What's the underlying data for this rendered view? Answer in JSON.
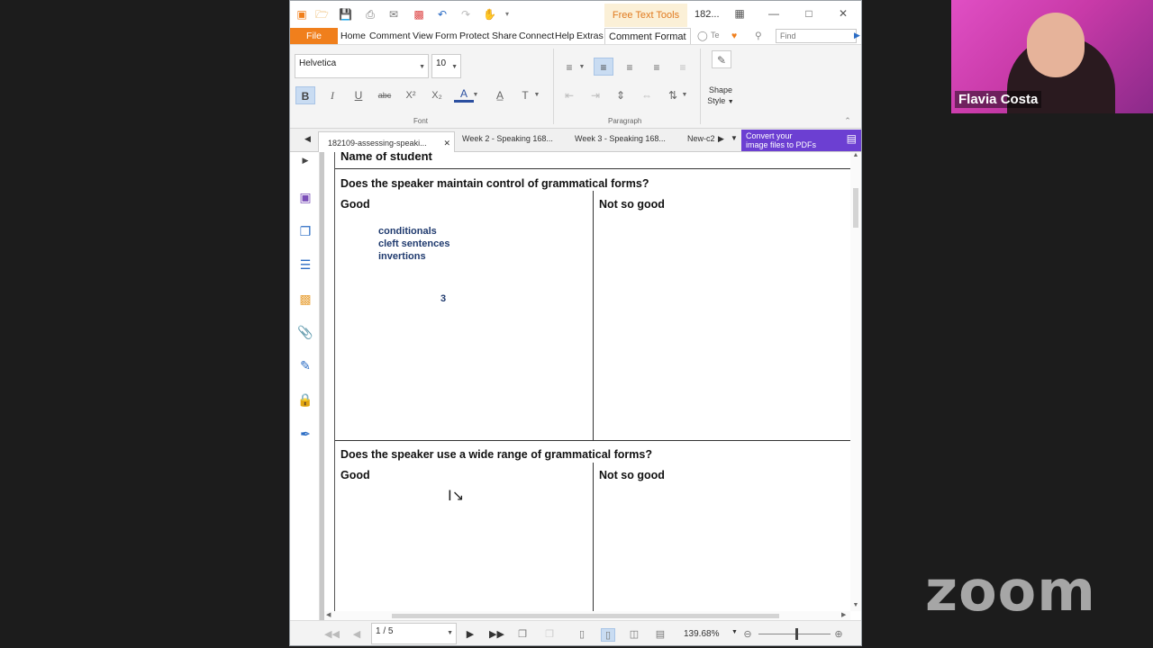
{
  "titlebar": {
    "active_tool_tab": "Free Text Tools",
    "doc_title": "182...",
    "colors": {
      "file_tab": "#f07f1c",
      "tool_tab_bg": "#fbf0d7",
      "tool_tab_text": "#e07a1f"
    }
  },
  "menu": {
    "file": "File",
    "items": [
      "Home",
      "Comment",
      "View",
      "Form",
      "Protect",
      "Share",
      "Connect",
      "Help",
      "Extras"
    ],
    "active": "Comment Format",
    "tell_me": "Te",
    "find_placeholder": "Find"
  },
  "ribbon": {
    "font_name": "Helvetica",
    "font_size": "10",
    "group_font": "Font",
    "group_paragraph": "Paragraph",
    "shape_style_1": "Shape",
    "shape_style_2": "Style"
  },
  "tabs": {
    "items": [
      "182109-assessing-speaki...",
      "Week 2 - Speaking 168...",
      "Week 3 - Speaking 168...",
      "New-c2"
    ],
    "banner_line1": "Convert your",
    "banner_line2": "image files to PDFs"
  },
  "document": {
    "name_of_student": "Name of student",
    "q1": "Does the speaker maintain control of grammatical forms?",
    "q1_good": "Good",
    "q1_not_good": "Not so good",
    "notes": [
      "conditionals",
      "cleft sentences",
      "invertions"
    ],
    "score": "3",
    "q2": "Does the speaker use a wide range of grammatical forms?",
    "q2_good": "Good",
    "q2_not_good": "Not so good"
  },
  "statusbar": {
    "page": "1 / 5",
    "zoom": "139.68%"
  },
  "zoom_call": {
    "speaker_name": "Flavia Costa",
    "logo": "zoom"
  }
}
